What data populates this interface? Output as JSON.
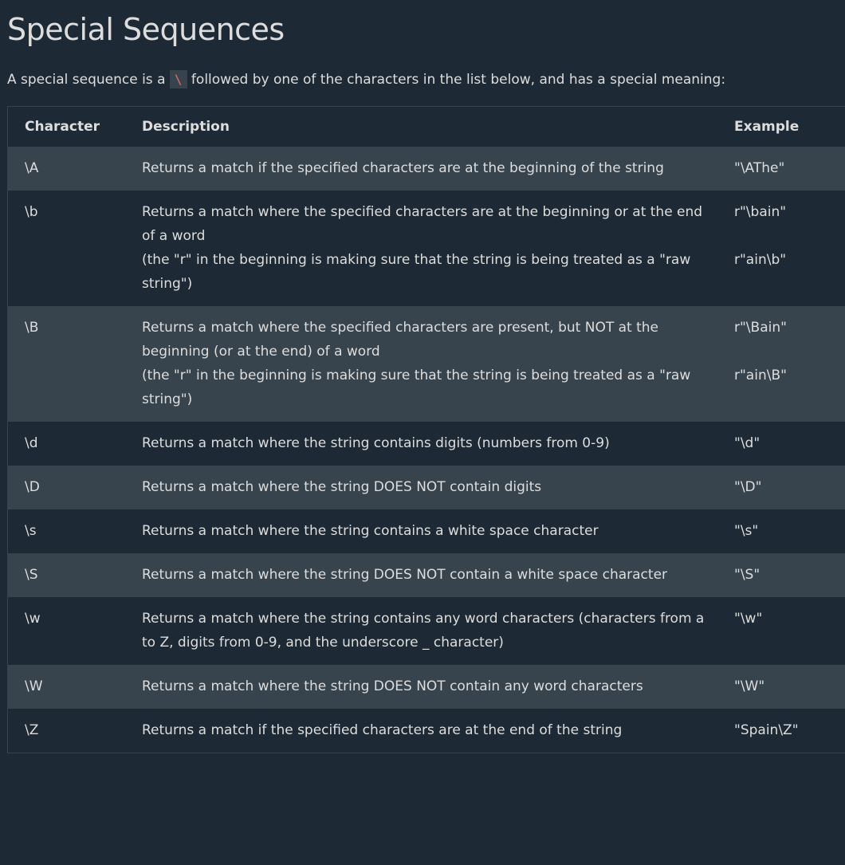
{
  "title": "Special Sequences",
  "intro": {
    "before": "A special sequence is a ",
    "code": "\\",
    "after": " followed by one of the characters in the list below, and has a special meaning:"
  },
  "table": {
    "headers": [
      "Character",
      "Description",
      "Example"
    ],
    "rows": [
      {
        "char": "\\A",
        "desc": [
          "Returns a match if the specified characters are at the beginning of the string"
        ],
        "example": [
          "\"\\AThe\""
        ]
      },
      {
        "char": "\\b",
        "desc": [
          "Returns a match where the specified characters are at the beginning or at the end of a word",
          "(the \"r\" in the beginning is making sure that the string is being treated as a \"raw string\")"
        ],
        "example": [
          "r\"\\bain\"",
          "r\"ain\\b\""
        ]
      },
      {
        "char": "\\B",
        "desc": [
          "Returns a match where the specified characters are present, but NOT at the beginning (or at the end) of a word",
          "(the \"r\" in the beginning is making sure that the string is being treated as a \"raw string\")"
        ],
        "example": [
          "r\"\\Bain\"",
          "r\"ain\\B\""
        ]
      },
      {
        "char": "\\d",
        "desc": [
          "Returns a match where the string contains digits (numbers from 0-9)"
        ],
        "example": [
          "\"\\d\""
        ]
      },
      {
        "char": "\\D",
        "desc": [
          "Returns a match where the string DOES NOT contain digits"
        ],
        "example": [
          "\"\\D\""
        ]
      },
      {
        "char": "\\s",
        "desc": [
          "Returns a match where the string contains a white space character"
        ],
        "example": [
          "\"\\s\""
        ]
      },
      {
        "char": "\\S",
        "desc": [
          "Returns a match where the string DOES NOT contain a white space character"
        ],
        "example": [
          "\"\\S\""
        ]
      },
      {
        "char": "\\w",
        "desc": [
          "Returns a match where the string contains any word characters (characters from a to Z, digits from 0-9, and the underscore _ character)"
        ],
        "example": [
          "\"\\w\""
        ]
      },
      {
        "char": "\\W",
        "desc": [
          "Returns a match where the string DOES NOT contain any word characters"
        ],
        "example": [
          "\"\\W\""
        ]
      },
      {
        "char": "\\Z",
        "desc": [
          "Returns a match if the specified characters are at the end of the string"
        ],
        "example": [
          "\"Spain\\Z\""
        ]
      }
    ]
  }
}
